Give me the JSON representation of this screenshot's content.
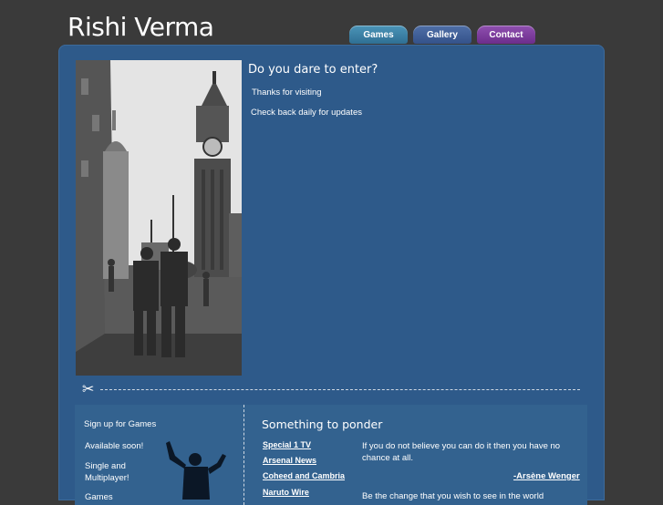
{
  "site": {
    "title": "Rishi Verma"
  },
  "nav": {
    "games": "Games",
    "gallery": "Gallery",
    "contact": "Contact"
  },
  "intro": {
    "heading": "Do you dare to enter?",
    "line1": "Thanks for visiting",
    "line2": "Check back daily for updates"
  },
  "signup": {
    "title": "Sign up for Games",
    "text1": "Available soon!",
    "text2": "Single and Multiplayer!",
    "text3": "Games"
  },
  "ponder": {
    "title": "Something to ponder",
    "links": [
      "Special 1 TV",
      "Arsenal News",
      "Coheed and Cambria",
      "Naruto Wire"
    ],
    "quote": "If you do not believe you can do it then you have no chance at all.",
    "author": "-Arsène Wenger",
    "quote2": "Be the change that you wish to see in the world"
  },
  "icons": {
    "scissors": "scissors-icon"
  },
  "colors": {
    "background": "#3a3a3a",
    "panel": "#2e5a8a",
    "games_tab": "#2f6f94",
    "gallery_tab": "#34528a",
    "contact_tab": "#6c2d8c"
  }
}
